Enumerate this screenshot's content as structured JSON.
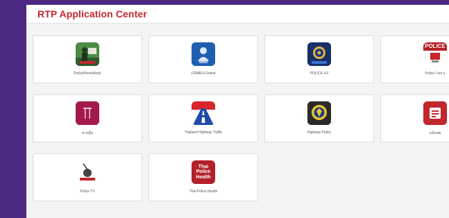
{
  "header": {
    "title": "RTP Application Center"
  },
  "apps": [
    {
      "label": "PolicePhoneBook",
      "icon": "phonebook-icon"
    },
    {
      "label": "CRIMES Online",
      "icon": "crimes-icon"
    },
    {
      "label": "POLICE 4.0",
      "icon": "police40-icon"
    },
    {
      "label": "Police I lert u",
      "icon": "police-ilertu-icon",
      "icon_text": "POLICE"
    },
    {
      "label": "ชานมือ",
      "icon": "red-door-icon"
    },
    {
      "label": "Thailand Highway Traffic",
      "icon": "highway-traffic-icon"
    },
    {
      "label": "Highway Police",
      "icon": "highway-police-icon"
    },
    {
      "label": "แจ้งเหตุ",
      "icon": "report-icon"
    },
    {
      "label": "Police TV",
      "icon": "police-tv-icon"
    },
    {
      "label": "Thai Police Health",
      "icon": "thai-police-health-icon",
      "icon_text": [
        "Thai",
        "Police",
        "Health"
      ]
    }
  ],
  "colors": {
    "accent": "#c4262b",
    "background": "#4a2a82"
  }
}
